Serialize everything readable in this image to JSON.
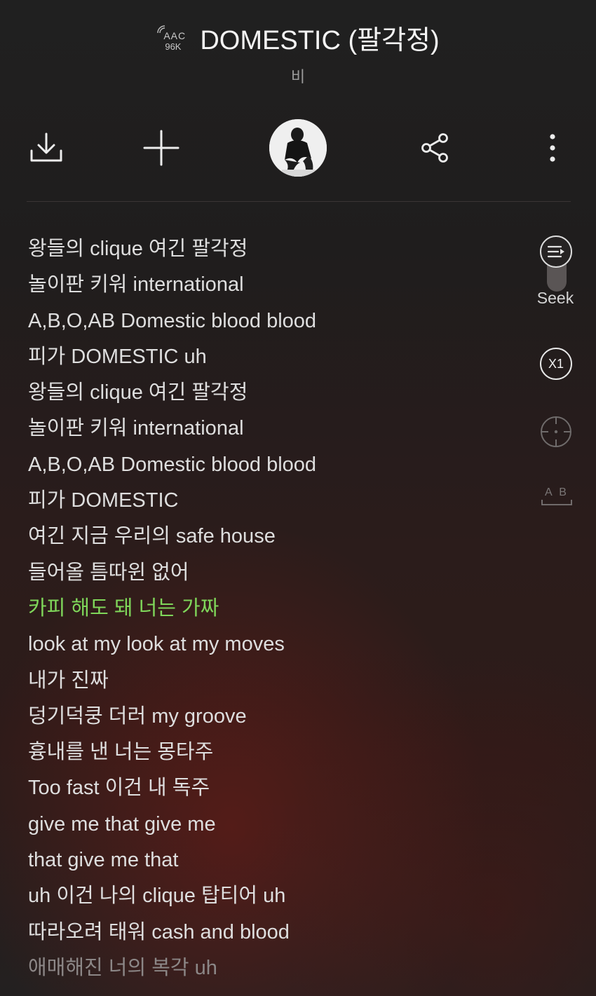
{
  "header": {
    "codec": "AAC",
    "bitrate": "96K",
    "title": "DOMESTIC (팔각정)",
    "artist": "비"
  },
  "actions": {
    "download": "download-icon",
    "add": "plus-icon",
    "album_art": "artist-avatar",
    "share": "share-icon",
    "more": "more-vertical-icon"
  },
  "lyrics": {
    "lines": [
      "왕들의 clique 여긴 팔각정",
      "놀이판 키워 international",
      "A,B,O,AB Domestic blood blood",
      "피가 DOMESTIC uh",
      "왕들의 clique 여긴 팔각정",
      "놀이판 키워 international",
      "A,B,O,AB Domestic blood blood",
      "피가 DOMESTIC",
      "여긴 지금 우리의 safe house",
      "들어올 틈따윈 없어",
      "카피 해도 돼 너는 가짜",
      "look at my look at my moves",
      "내가 진짜",
      "덩기덕쿵 더러 my groove",
      "흉내를 낸 너는 몽타주",
      "Too fast 이건 내 독주",
      "give me that give me",
      "that give me that",
      "uh 이건 나의 clique 탑티어 uh",
      "따라오려 태워 cash and blood",
      "애매해진 너의 복각 uh"
    ],
    "active_index": 10,
    "active_color": "#7fd65a"
  },
  "side_controls": {
    "seek_label": "Seek",
    "speed_label": "X1",
    "ab_label": "A B"
  }
}
